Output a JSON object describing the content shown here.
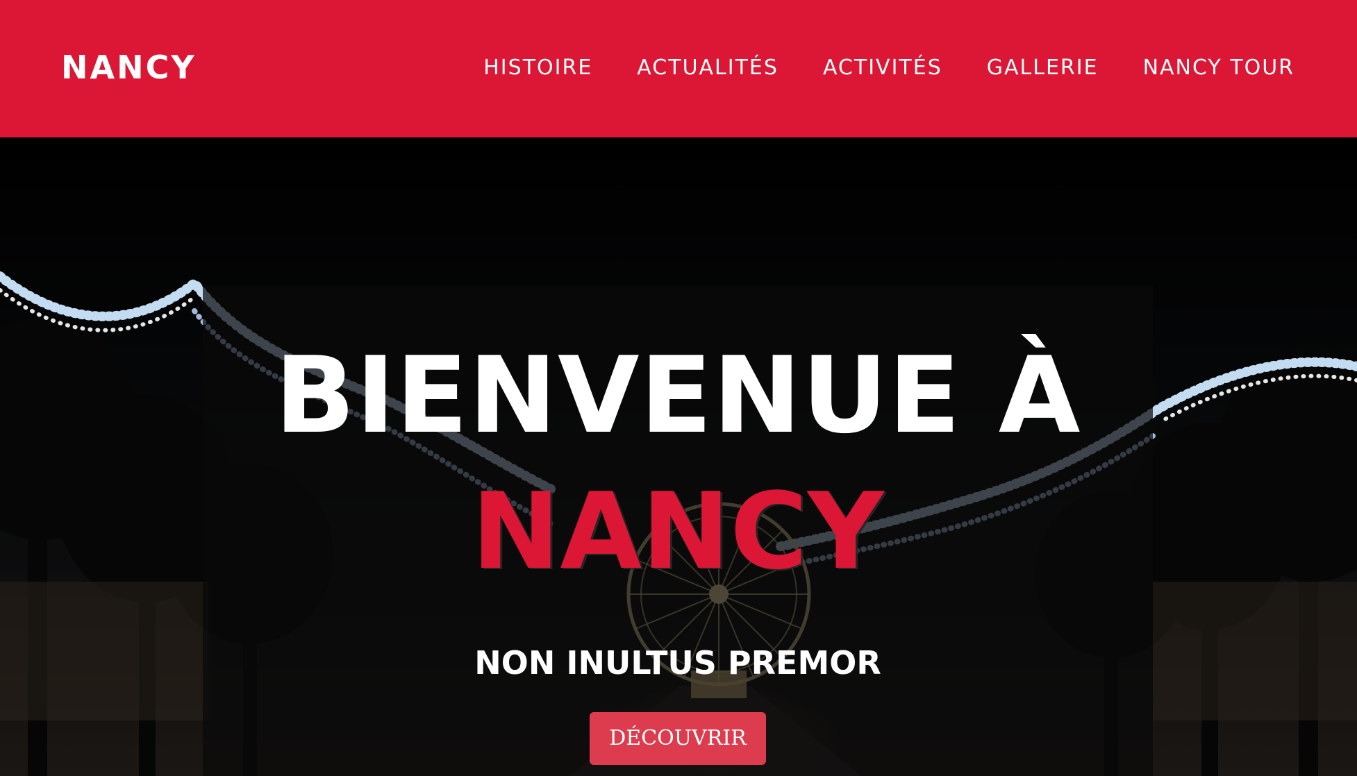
{
  "header": {
    "brand": "NANCY",
    "nav": [
      {
        "label": "HISTOIRE"
      },
      {
        "label": "ACTUALITÉS"
      },
      {
        "label": "ACTIVITÉS"
      },
      {
        "label": "GALLERIE"
      },
      {
        "label": "NANCY TOUR"
      }
    ]
  },
  "hero": {
    "title_line1": "BIENVENUE À",
    "title_line2": "NANCY",
    "tagline": "NON INULTUS PREMOR",
    "cta_label": "DÉCOUVRIR",
    "background_image": "night-avenue-christmas-lights-ferris-wheel"
  },
  "colors": {
    "brand_red": "#dc1735",
    "button_red": "#dc3c4e",
    "white": "#ffffff"
  }
}
